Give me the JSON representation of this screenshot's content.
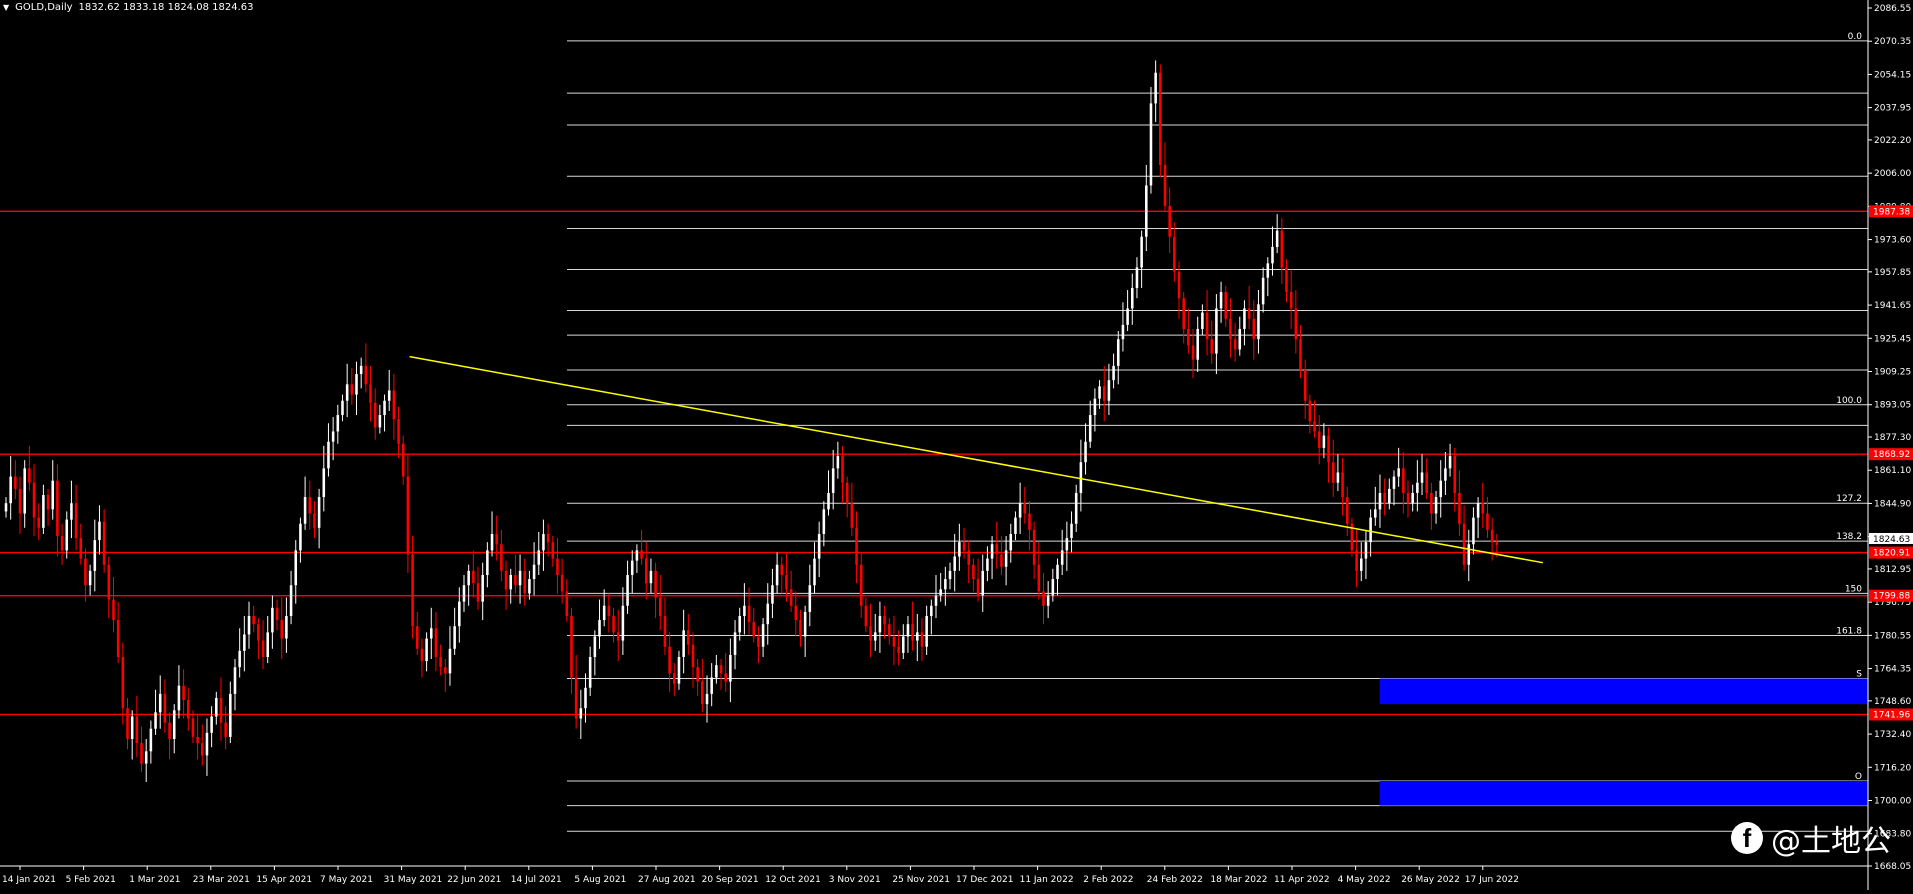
{
  "header": {
    "symbol": "GOLD,Daily",
    "ohlc": "1832.62 1833.18 1824.08 1824.63"
  },
  "watermark": {
    "icon": "facebook-icon",
    "text": "@土地公"
  },
  "colors": {
    "background": "#000000",
    "bull": "#ffffff",
    "bear": "#ff0000",
    "resistance": "#ff0000",
    "fib": "#ffffff",
    "trendline": "#ffff00",
    "zone": "#0000ff"
  },
  "chart_data": {
    "type": "candlestick",
    "symbol": "GOLD",
    "timeframe": "Daily",
    "ylim": [
      1668.05,
      2086.55
    ],
    "y_ticks": [
      "2086.55",
      "2070.35",
      "2054.15",
      "2037.95",
      "2022.20",
      "2006.00",
      "1989.80",
      "1973.60",
      "1957.85",
      "1941.65",
      "1925.45",
      "1909.25",
      "1893.05",
      "1877.30",
      "1861.10",
      "1844.90",
      "1828.70",
      "1812.95",
      "1796.75",
      "1780.55",
      "1764.35",
      "1748.60",
      "1732.40",
      "1716.20",
      "1700.00",
      "1683.80",
      "1668.05"
    ],
    "x_labels": [
      "14 Jan 2021",
      "5 Feb 2021",
      "1 Mar 2021",
      "23 Mar 2021",
      "15 Apr 2021",
      "7 May 2021",
      "31 May 2021",
      "22 Jun 2021",
      "14 Jul 2021",
      "5 Aug 2021",
      "27 Aug 2021",
      "20 Sep 2021",
      "12 Oct 2021",
      "3 Nov 2021",
      "25 Nov 2021",
      "17 Dec 2021",
      "11 Jan 2022",
      "2 Feb 2022",
      "24 Feb 2022",
      "18 Mar 2022",
      "11 Apr 2022",
      "4 May 2022",
      "26 May 2022",
      "17 Jun 2022"
    ],
    "current_price": "1824.63",
    "horizontal_lines": [
      {
        "price": 1987.38,
        "label": "1987.38",
        "color": "#ff0000"
      },
      {
        "price": 1868.92,
        "label": "1868.92",
        "color": "#ff0000"
      },
      {
        "price": 1820.91,
        "label": "1820.91",
        "color": "#ff0000"
      },
      {
        "price": 1799.88,
        "label": "1799.88",
        "color": "#ff0000"
      },
      {
        "price": 1741.96,
        "label": "1741.96",
        "color": "#ff0000"
      }
    ],
    "fib_levels": [
      {
        "price": 2070.5,
        "label": "0.0"
      },
      {
        "price": 2045.0,
        "label": ""
      },
      {
        "price": 2029.5,
        "label": ""
      },
      {
        "price": 2004.5,
        "label": ""
      },
      {
        "price": 1979.0,
        "label": ""
      },
      {
        "price": 1959.0,
        "label": ""
      },
      {
        "price": 1939.0,
        "label": ""
      },
      {
        "price": 1927.0,
        "label": ""
      },
      {
        "price": 1910.0,
        "label": ""
      },
      {
        "price": 1893.0,
        "label": "100.0"
      },
      {
        "price": 1883.0,
        "label": ""
      },
      {
        "price": 1845.0,
        "label": "127.2"
      },
      {
        "price": 1826.5,
        "label": "138.2"
      },
      {
        "price": 1801.0,
        "label": "150"
      },
      {
        "price": 1780.5,
        "label": "161.8"
      },
      {
        "price": 1759.5,
        "label": "S"
      },
      {
        "price": 1709.5,
        "label": "O"
      },
      {
        "price": 1697.5,
        "label": ""
      },
      {
        "price": 1685.0,
        "label": ""
      }
    ],
    "zones": [
      {
        "from": 1747.0,
        "to": 1759.5,
        "start": "4 May 2022"
      },
      {
        "from": 1697.5,
        "to": 1709.5,
        "start": "4 May 2022"
      }
    ],
    "trendline": {
      "from": {
        "date": "31 May 2021",
        "price": 1916.5
      },
      "to": {
        "date": "17 Jun 2022",
        "price": 1816.0
      }
    },
    "series": [
      {
        "values": [
          1845,
          1858,
          1852,
          1840,
          1862,
          1855,
          1838,
          1833,
          1849,
          1842,
          1856,
          1829,
          1822,
          1837,
          1845,
          1828,
          1818,
          1805,
          1812,
          1827,
          1836,
          1815,
          1798,
          1788,
          1770,
          1745,
          1730,
          1741,
          1728,
          1718,
          1724,
          1735,
          1743,
          1752,
          1738,
          1730,
          1744,
          1756,
          1749,
          1740,
          1731,
          1728,
          1722,
          1733,
          1741,
          1750,
          1738,
          1731,
          1752,
          1765,
          1773,
          1781,
          1790,
          1786,
          1778,
          1770,
          1782,
          1794,
          1788,
          1779,
          1790,
          1805,
          1822,
          1835,
          1848,
          1840,
          1833,
          1848,
          1862,
          1875,
          1880,
          1888,
          1895,
          1903,
          1898,
          1908,
          1912,
          1903,
          1894,
          1882,
          1888,
          1895,
          1900,
          1886,
          1874,
          1858,
          1820,
          1785,
          1774,
          1768,
          1779,
          1784,
          1770,
          1765,
          1762,
          1774,
          1785,
          1797,
          1805,
          1812,
          1806,
          1797,
          1810,
          1822,
          1830,
          1825,
          1812,
          1803,
          1810,
          1805,
          1812,
          1801,
          1808,
          1815,
          1822,
          1830,
          1826,
          1818,
          1810,
          1802,
          1790,
          1760,
          1740,
          1745,
          1755,
          1770,
          1780,
          1788,
          1795,
          1790,
          1782,
          1778,
          1795,
          1810,
          1817,
          1822,
          1818,
          1806,
          1812,
          1799,
          1790,
          1775,
          1762,
          1757,
          1770,
          1783,
          1776,
          1765,
          1758,
          1747,
          1752,
          1760,
          1766,
          1762,
          1758,
          1771,
          1782,
          1790,
          1795,
          1787,
          1780,
          1775,
          1786,
          1796,
          1805,
          1815,
          1810,
          1803,
          1795,
          1788,
          1780,
          1792,
          1805,
          1818,
          1830,
          1842,
          1850,
          1862,
          1868,
          1855,
          1845,
          1833,
          1815,
          1795,
          1785,
          1778,
          1782,
          1790,
          1786,
          1780,
          1775,
          1772,
          1780,
          1786,
          1778,
          1782,
          1775,
          1790,
          1795,
          1800,
          1803,
          1808,
          1812,
          1819,
          1826,
          1822,
          1815,
          1808,
          1800,
          1812,
          1818,
          1825,
          1820,
          1814,
          1822,
          1830,
          1838,
          1845,
          1840,
          1832,
          1815,
          1802,
          1795,
          1800,
          1808,
          1815,
          1822,
          1828,
          1835,
          1850,
          1865,
          1875,
          1888,
          1896,
          1902,
          1895,
          1905,
          1912,
          1925,
          1932,
          1940,
          1950,
          1960,
          1975,
          2000,
          2040,
          2055,
          2010,
          1990,
          1975,
          1958,
          1945,
          1930,
          1922,
          1915,
          1930,
          1938,
          1925,
          1918,
          1940,
          1948,
          1935,
          1925,
          1920,
          1930,
          1940,
          1935,
          1925,
          1942,
          1955,
          1962,
          1970,
          1978,
          1960,
          1948,
          1940,
          1925,
          1910,
          1895,
          1885,
          1880,
          1872,
          1878,
          1865,
          1855,
          1860,
          1848,
          1835,
          1822,
          1812,
          1818,
          1826,
          1838,
          1842,
          1850,
          1845,
          1852,
          1858,
          1862,
          1850,
          1845,
          1850,
          1855,
          1860,
          1850,
          1840,
          1848,
          1856,
          1862,
          1868,
          1850,
          1835,
          1815,
          1825,
          1838,
          1845,
          1840,
          1832,
          1826,
          1824.63
        ]
      }
    ]
  }
}
